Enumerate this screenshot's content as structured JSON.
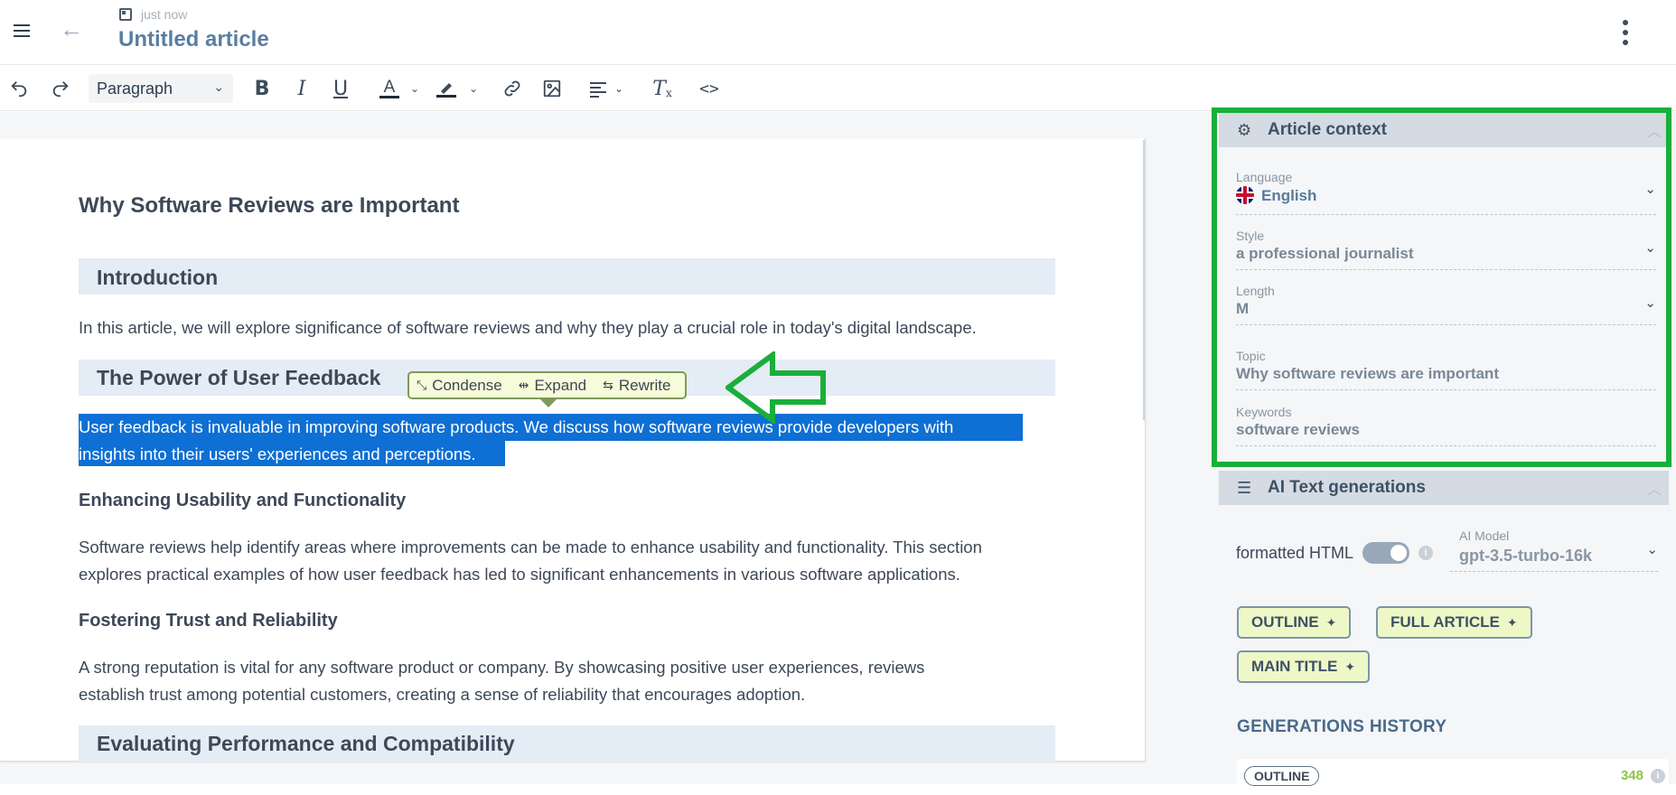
{
  "header": {
    "timestamp": "just now",
    "title": "Untitled article"
  },
  "toolbar": {
    "block_format": "Paragraph"
  },
  "article": {
    "h1": "Why Software Reviews are Important",
    "sections": [
      {
        "heading": "Introduction"
      },
      {
        "paragraph": "In this article, we will explore significance of software reviews and why they play a crucial role in today's digital landscape."
      },
      {
        "heading": "The Power of User Feedback"
      },
      {
        "selected_line1": "User feedback is invaluable in improving software products. We discuss how software reviews provide developers with",
        "selected_line2": "insights into their users' experiences and perceptions."
      },
      {
        "subheading": "Enhancing Usability and Functionality"
      },
      {
        "paragraph_line1": "Software reviews help identify areas where improvements can be made to enhance usability and functionality. This section",
        "paragraph_line2": "explores practical examples of how user feedback has led to significant enhancements in various software applications."
      },
      {
        "subheading": "Fostering Trust and Reliability"
      },
      {
        "paragraph_line1": "A strong reputation is vital for any software product or company. By showcasing positive user experiences, reviews",
        "paragraph_line2": "establish trust among potential customers, creating a sense of reliability that encourages adoption."
      },
      {
        "heading": "Evaluating Performance and Compatibility"
      }
    ]
  },
  "selection_popup": {
    "condense": "Condense",
    "expand": "Expand",
    "rewrite": "Rewrite"
  },
  "article_context": {
    "title": "Article context",
    "language_label": "Language",
    "language_value": "English",
    "style_label": "Style",
    "style_value": "a professional journalist",
    "length_label": "Length",
    "length_value": "M",
    "topic_label": "Topic",
    "topic_value": "Why software reviews are important",
    "keywords_label": "Keywords",
    "keywords_value": "software reviews"
  },
  "ai_generations": {
    "title": "AI Text generations",
    "formatted_html_label": "formatted HTML",
    "model_label": "AI Model",
    "model_value": "gpt-3.5-turbo-16k",
    "buttons": {
      "outline": "OUTLINE",
      "full_article": "FULL ARTICLE",
      "main_title": "MAIN TITLE"
    },
    "history_title": "GENERATIONS HISTORY",
    "history_items": [
      {
        "type": "OUTLINE",
        "count": "348"
      }
    ]
  },
  "colors": {
    "accent_green": "#1aae3a",
    "selection_blue": "#0e6fd4",
    "heading_band": "#e4ecf5",
    "gen_button_bg": "#eef8c7"
  }
}
